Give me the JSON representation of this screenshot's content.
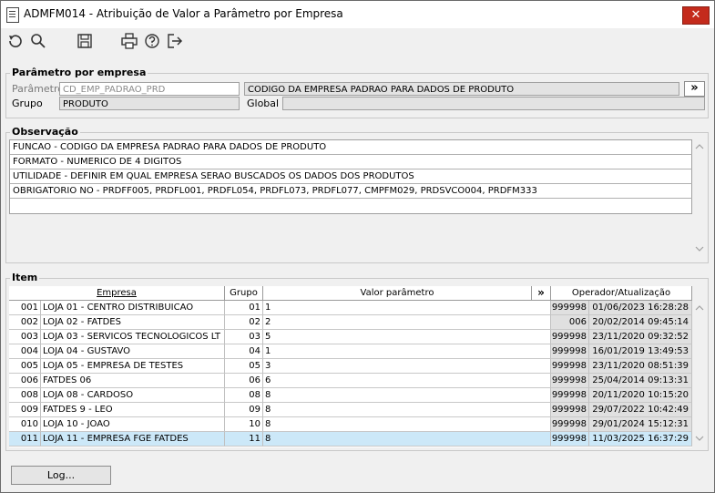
{
  "window": {
    "title": "ADMFM014 - Atribuição de Valor a Parâmetro por Empresa",
    "close_symbol": "✕"
  },
  "toolbar": {
    "icons": [
      "undo-icon",
      "search-icon",
      "save-icon",
      "print-icon",
      "help-icon",
      "exit-icon"
    ]
  },
  "param_group": {
    "label": "Parâmetro por empresa",
    "parametro_label": "Parâmetro",
    "parametro_value": "CD_EMP_PADRAO_PRD",
    "descricao_value": "CODIGO DA EMPRESA PADRAO PARA DADOS DE PRODUTO",
    "expand_symbol": "»",
    "grupo_label": "Grupo",
    "grupo_value": "PRODUTO",
    "global_label": "Global",
    "global_value": ""
  },
  "obs_group": {
    "label": "Observação",
    "lines": [
      "FUNCAO - CODIGO DA EMPRESA PADRAO PARA DADOS DE PRODUTO",
      "FORMATO - NUMERICO DE 4 DIGITOS",
      "UTILIDADE - DEFINIR EM QUAL EMPRESA SERAO BUSCADOS OS DADOS DOS PRODUTOS",
      "OBRIGATORIO NO - PRDFF005, PRDFL001, PRDFL054, PRDFL073, PRDFL077, CMPFM029, PRDSVCO004, PRDFM333",
      ""
    ]
  },
  "item_group": {
    "label": "Item",
    "headers": {
      "empresa": "Empresa",
      "grupo": "Grupo",
      "valor": "Valor parâmetro",
      "expand": "»",
      "operador": "Operador/Atualização"
    },
    "rows": [
      {
        "num": "001",
        "empresa": "LOJA 01 - CENTRO DISTRIBUICAO",
        "grupo": "01",
        "valor": "1",
        "operador": "999998",
        "data": "01/06/2023 16:28:28"
      },
      {
        "num": "002",
        "empresa": "LOJA 02 - FATDES",
        "grupo": "02",
        "valor": "2",
        "operador": "006",
        "data": "20/02/2014 09:45:14"
      },
      {
        "num": "003",
        "empresa": "LOJA 03 - SERVICOS TECNOLOGICOS LT",
        "grupo": "03",
        "valor": "5",
        "operador": "999998",
        "data": "23/11/2020 09:32:52"
      },
      {
        "num": "004",
        "empresa": "LOJA 04 - GUSTAVO",
        "grupo": "04",
        "valor": "1",
        "operador": "999998",
        "data": "16/01/2019 13:49:53"
      },
      {
        "num": "005",
        "empresa": "LOJA 05 - EMPRESA DE TESTES",
        "grupo": "05",
        "valor": "3",
        "operador": "999998",
        "data": "23/11/2020 08:51:39"
      },
      {
        "num": "006",
        "empresa": "FATDES 06",
        "grupo": "06",
        "valor": "6",
        "operador": "999998",
        "data": "25/04/2014 09:13:31"
      },
      {
        "num": "008",
        "empresa": "LOJA 08 - CARDOSO",
        "grupo": "08",
        "valor": "8",
        "operador": "999998",
        "data": "20/11/2020 10:15:20"
      },
      {
        "num": "009",
        "empresa": "FATDES 9 - LEO",
        "grupo": "09",
        "valor": "8",
        "operador": "999998",
        "data": "29/07/2022 10:42:49"
      },
      {
        "num": "010",
        "empresa": "LOJA 10 - JOAO",
        "grupo": "10",
        "valor": "8",
        "operador": "999998",
        "data": "29/01/2024 15:12:31"
      },
      {
        "num": "011",
        "empresa": "LOJA 11 - EMPRESA FGE FATDES",
        "grupo": "11",
        "valor": "8",
        "operador": "999998",
        "data": "11/03/2025 16:37:29"
      }
    ],
    "selected_row": 9
  },
  "footer": {
    "log_button": "Log..."
  },
  "colors": {
    "close": "#c42b1c",
    "selected_row": "#cce8f8",
    "readonly_cell": "#e0e0e0"
  }
}
